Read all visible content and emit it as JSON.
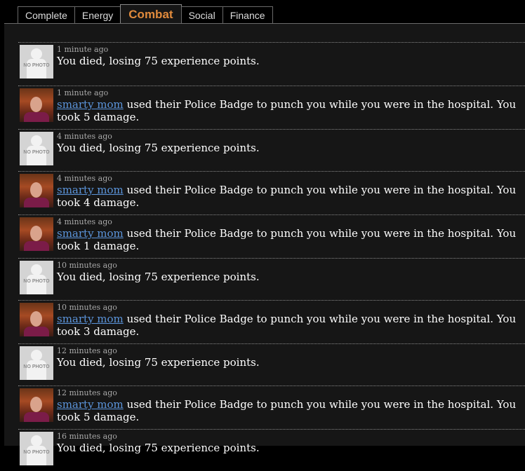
{
  "tabs": [
    {
      "label": "Complete",
      "active": false
    },
    {
      "label": "Energy",
      "active": false
    },
    {
      "label": "Combat",
      "active": true
    },
    {
      "label": "Social",
      "active": false
    },
    {
      "label": "Finance",
      "active": false
    }
  ],
  "nophoto_label": "NO PHOTO",
  "feed": [
    {
      "type": "death",
      "time": "1 minute ago",
      "text": "You died, losing 75 experience points."
    },
    {
      "type": "punch",
      "time": "1 minute ago",
      "user": "smarty mom",
      "text": " used their Police Badge to punch you while you were in the hospital. You took 5 damage."
    },
    {
      "type": "death",
      "time": "4 minutes ago",
      "text": "You died, losing 75 experience points."
    },
    {
      "type": "punch",
      "time": "4 minutes ago",
      "user": "smarty mom",
      "text": " used their Police Badge to punch you while you were in the hospital. You took 4 damage."
    },
    {
      "type": "punch",
      "time": "4 minutes ago",
      "user": "smarty mom",
      "text": " used their Police Badge to punch you while you were in the hospital. You took 1 damage."
    },
    {
      "type": "death",
      "time": "10 minutes ago",
      "text": "You died, losing 75 experience points."
    },
    {
      "type": "punch",
      "time": "10 minutes ago",
      "user": "smarty mom",
      "text": " used their Police Badge to punch you while you were in the hospital. You took 3 damage."
    },
    {
      "type": "death",
      "time": "12 minutes ago",
      "text": "You died, losing 75 experience points."
    },
    {
      "type": "punch",
      "time": "12 minutes ago",
      "user": "smarty mom",
      "text": " used their Police Badge to punch you while you were in the hospital. You took 5 damage."
    },
    {
      "type": "death",
      "time": "16 minutes ago",
      "text": "You died, losing 75 experience points."
    }
  ],
  "colors": {
    "accent": "#e08a3c",
    "link": "#5b94da",
    "panel": "#161616",
    "background": "#000000"
  }
}
